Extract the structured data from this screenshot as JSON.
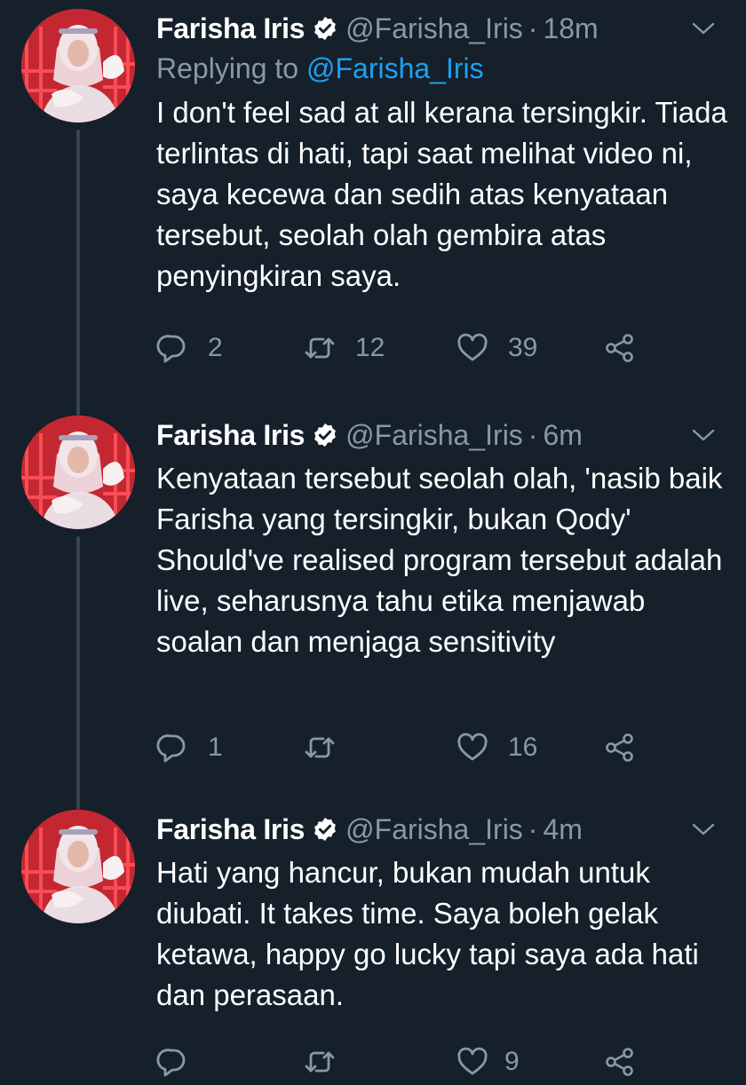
{
  "colors": {
    "background": "#15202b",
    "secondary_text": "#8899a6",
    "link": "#1da1f2",
    "thread_line": "#38444d"
  },
  "tweets": [
    {
      "display_name": "Farisha Iris",
      "handle": "@Farisha_Iris",
      "separator": "·",
      "time": "18m",
      "replying_prefix": "Replying to",
      "replying_to": "@Farisha_Iris",
      "text": "I don't feel sad at all kerana tersingkir. Tiada terlintas di hati, tapi saat melihat video ni, saya kecewa dan sedih atas kenyataan tersebut, seolah olah gembira atas penyingkiran saya.",
      "replies": "2",
      "retweets": "12",
      "likes": "39"
    },
    {
      "display_name": "Farisha Iris",
      "handle": "@Farisha_Iris",
      "separator": "·",
      "time": "6m",
      "text": "Kenyataan tersebut seolah olah, 'nasib baik Farisha yang tersingkir, bukan Qody' Should've realised program tersebut adalah live, seharusnya tahu etika menjawab soalan dan menjaga sensitivity",
      "replies": "1",
      "retweets": "",
      "likes": "16"
    },
    {
      "display_name": "Farisha Iris",
      "handle": "@Farisha_Iris",
      "separator": "·",
      "time": "4m",
      "text": "Hati yang hancur, bukan mudah untuk diubati. It takes time. Saya boleh gelak ketawa, happy go lucky tapi saya ada hati dan perasaan.",
      "replies": "",
      "retweets": "",
      "likes": "9"
    }
  ],
  "icons": {
    "avatar": "profile-photo",
    "verified": "verified-badge-icon",
    "caret": "chevron-down-icon",
    "reply": "reply-bubble-icon",
    "retweet": "retweet-icon",
    "like": "heart-icon",
    "share": "share-icon"
  }
}
